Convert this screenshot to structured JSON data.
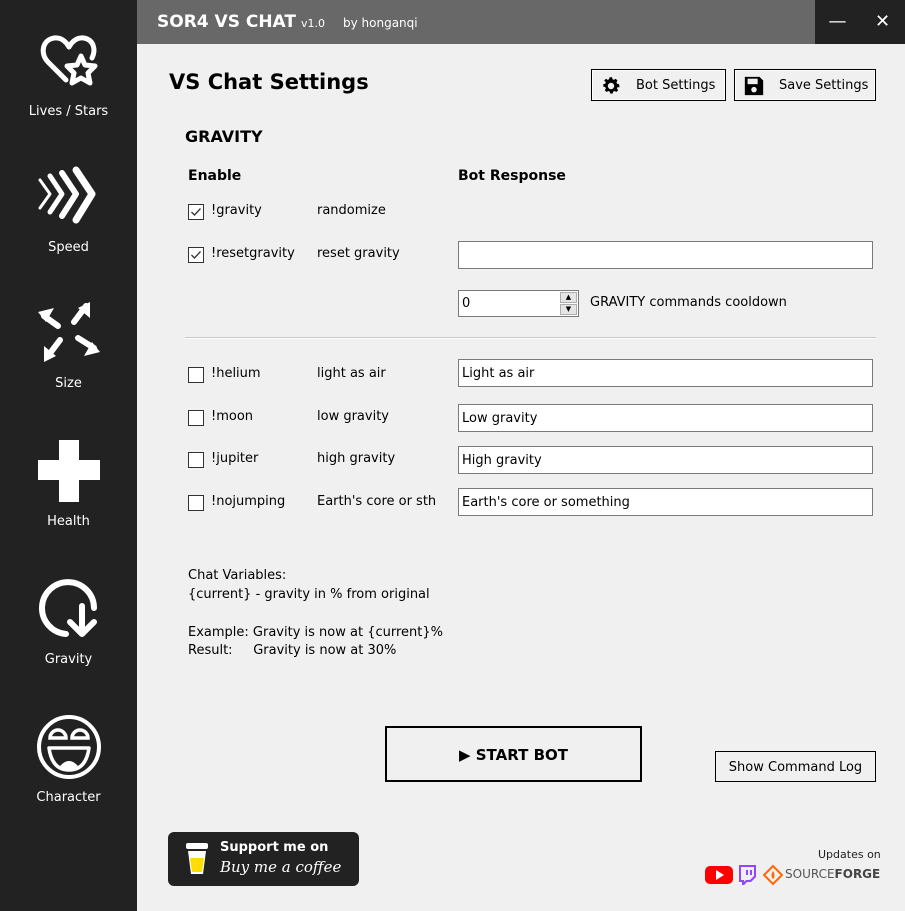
{
  "window": {
    "app_title": "SOR4 VS CHAT",
    "version": "v1.0",
    "author": "by honganqi",
    "minimize_glyph": "—",
    "close_glyph": "✕"
  },
  "sidebar": {
    "items": [
      {
        "label": "Lives / Stars",
        "icon": "heart-star-icon"
      },
      {
        "label": "Speed",
        "icon": "chevrons-right-icon"
      },
      {
        "label": "Size",
        "icon": "expand-arrows-icon"
      },
      {
        "label": "Health",
        "icon": "plus-cross-icon"
      },
      {
        "label": "Gravity",
        "icon": "gravity-circle-arrow-icon"
      },
      {
        "label": "Character",
        "icon": "laughing-face-icon"
      }
    ]
  },
  "header": {
    "title": "VS Chat Settings",
    "bot_settings_label": "Bot Settings",
    "save_settings_label": "Save Settings"
  },
  "section": {
    "title": "GRAVITY",
    "enable_header": "Enable",
    "response_header": "Bot Response",
    "commands": [
      {
        "command": "!gravity",
        "description": "randomize",
        "checked": true,
        "response": null
      },
      {
        "command": "!resetgravity",
        "description": "reset gravity",
        "checked": true,
        "response": ""
      },
      {
        "command": "!helium",
        "description": "light as air",
        "checked": false,
        "response": "Light as air"
      },
      {
        "command": "!moon",
        "description": "low gravity",
        "checked": false,
        "response": "Low gravity"
      },
      {
        "command": "!jupiter",
        "description": "high gravity",
        "checked": false,
        "response": "High gravity"
      },
      {
        "command": "!nojumping",
        "description": "Earth's core or sth",
        "checked": false,
        "response": "Earth's core or something"
      }
    ],
    "cooldown": {
      "value": "0",
      "label": "GRAVITY commands cooldown"
    }
  },
  "info": {
    "line1": "Chat Variables:",
    "line2": "{current} - gravity in % from original",
    "line3": "Example: Gravity is now at {current}%",
    "line4": "Result:     Gravity is now at 30%"
  },
  "actions": {
    "start_label": "▶ START BOT",
    "log_label": "Show Command Log"
  },
  "footer": {
    "bmc_line1": "Support me on",
    "bmc_line2": "Buy me a coffee",
    "updates_label": "Updates on",
    "sourceforge_a": "SOURCE",
    "sourceforge_b": "FORGE"
  },
  "colors": {
    "sidebar_bg": "#222222",
    "titlebar_bg": "#686868",
    "content_bg": "#f0f0f0",
    "youtube": "#ff0000",
    "twitch": "#9146ff",
    "sourceforge": "#ff6600",
    "bmc_cup": "#ffdd00"
  }
}
